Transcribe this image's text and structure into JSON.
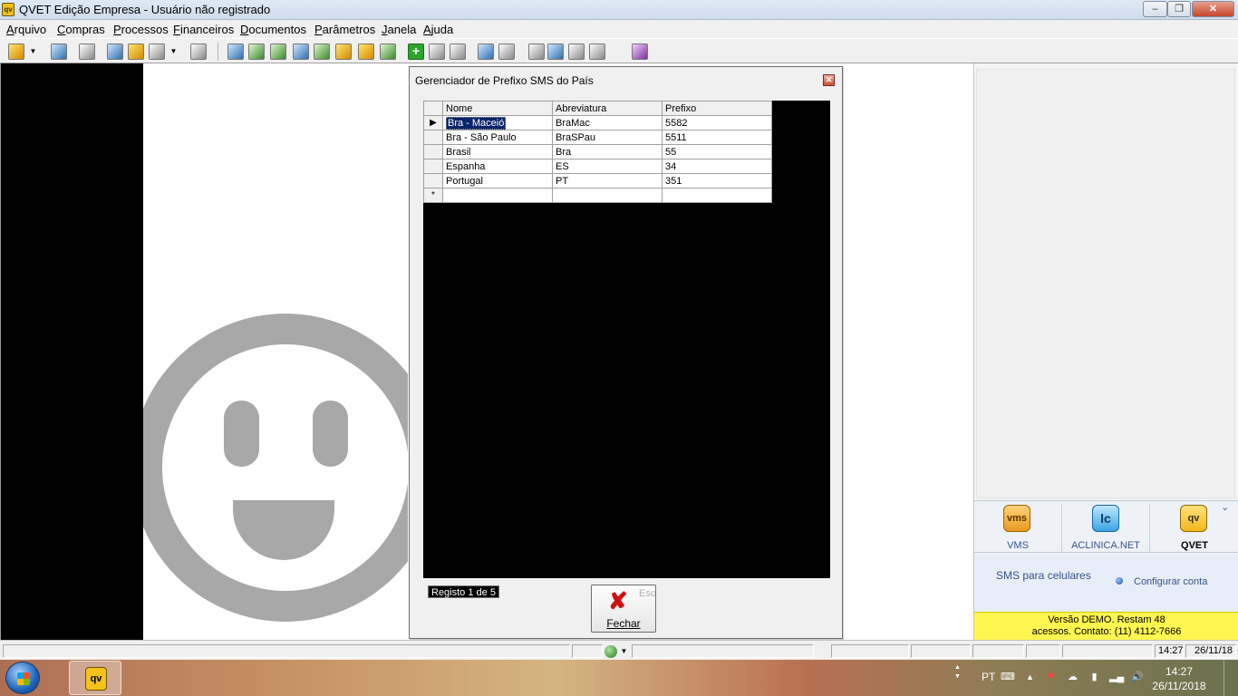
{
  "window": {
    "title": "QVET Edição Empresa - Usuário não registrado",
    "app_icon": "qv"
  },
  "menu": [
    "Arquivo",
    "Compras",
    "Processos",
    "Financeiros",
    "Documentos",
    "Parâmetros",
    "Janela",
    "Ajuda"
  ],
  "dialog": {
    "title": "Gerenciador de Prefixo SMS do País",
    "columns": [
      "Nome",
      "Abreviatura",
      "Prefixo"
    ],
    "rows": [
      {
        "nome": "Bra - Maceió",
        "abreviatura": "BraMac",
        "prefixo": "5582"
      },
      {
        "nome": "Bra - São Paulo",
        "abreviatura": "BraSPau",
        "prefixo": "5511"
      },
      {
        "nome": "Brasil",
        "abreviatura": "Bra",
        "prefixo": "55"
      },
      {
        "nome": "Espanha",
        "abreviatura": "ES",
        "prefixo": "34"
      },
      {
        "nome": "Portugal",
        "abreviatura": "PT",
        "prefixo": "351"
      }
    ],
    "current_row_marker": "▶",
    "new_row_marker": "*",
    "record_status": "Registo 1 de 5",
    "close_button": {
      "label": "Fechar",
      "shortcut": "Esc"
    }
  },
  "right_panel": {
    "apps": [
      {
        "icon_text": "vms",
        "label": "VMS"
      },
      {
        "icon_text": "lc",
        "label": "ACLINICA.NET"
      },
      {
        "icon_text": "qv",
        "label": "QVET"
      }
    ],
    "sms_label": "SMS para celulares",
    "configure_label": "Configurar conta",
    "demo_line1": "Versão DEMO. Restam 48",
    "demo_line2": "acessos. Contato: (11) 4112-7666"
  },
  "statusbar": {
    "time": "14:27",
    "date": "26/11/18"
  },
  "taskbar": {
    "language": "PT",
    "clock_time": "14:27",
    "clock_date": "26/11/2018"
  },
  "colors": {
    "accent_yellow": "#fff64f",
    "grid_background": "#000000",
    "selection": "#0a246a"
  }
}
